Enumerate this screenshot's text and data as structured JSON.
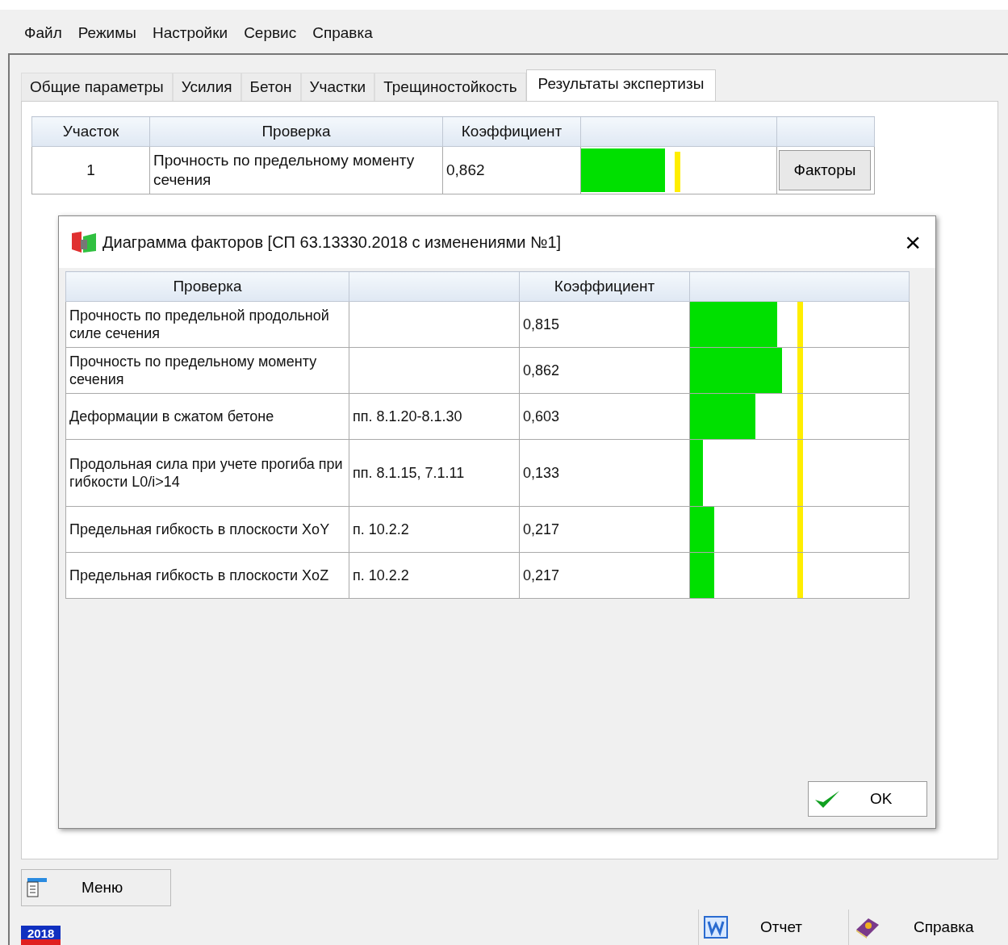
{
  "menu": [
    "Файл",
    "Режимы",
    "Настройки",
    "Сервис",
    "Справка"
  ],
  "tabs": [
    {
      "label": "Общие параметры",
      "selected": false
    },
    {
      "label": "Усилия",
      "selected": false
    },
    {
      "label": "Бетон",
      "selected": false
    },
    {
      "label": "Участки",
      "selected": false
    },
    {
      "label": "Трещиностойкость",
      "selected": false
    },
    {
      "label": "Результаты экспертизы",
      "selected": true
    }
  ],
  "results_table": {
    "columns": [
      "Участок",
      "Проверка",
      "Коэффициент"
    ],
    "rows": [
      {
        "section": "1",
        "check": "Прочность по предельному моменту сечения",
        "coefficient": "0,862",
        "level": 0.43,
        "button": "Факторы"
      }
    ]
  },
  "dialog": {
    "title": "Диаграмма факторов [СП 63.13330.2018 с изменениями №1]",
    "close": "×",
    "columns": [
      "Проверка",
      "Коэффициент"
    ],
    "rows": [
      {
        "check": "Прочность по предельной продольной силе сечения",
        "clause": "",
        "coefficient": "0,815",
        "level": 0.4
      },
      {
        "check": "Прочность по предельному моменту сечения",
        "clause": "",
        "coefficient": "0,862",
        "level": 0.42
      },
      {
        "check": "Деформации в сжатом бетоне",
        "clause": "пп. 8.1.20-8.1.30",
        "coefficient": "0,603",
        "level": 0.3
      },
      {
        "check": "Продольная сила при учете прогиба при гибкости L0/i>14",
        "clause": "пп. 8.1.15, 7.1.11",
        "coefficient": "0,133",
        "level": 0.06
      },
      {
        "check": "Предельная гибкость в плоскости XoY",
        "clause": "п. 10.2.2",
        "coefficient": "0,217",
        "level": 0.11
      },
      {
        "check": "Предельная гибкость в плоскости XoZ",
        "clause": "п. 10.2.2",
        "coefficient": "0,217",
        "level": 0.11
      }
    ],
    "ok_button": "OK"
  },
  "menu_button": "Меню",
  "version_badge": "2018",
  "report_button": "Отчет",
  "help_button": "Справка"
}
